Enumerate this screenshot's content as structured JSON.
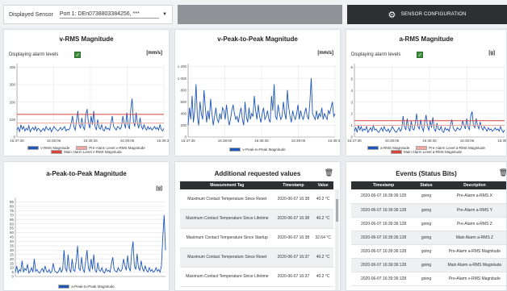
{
  "header": {
    "sensor_label": "Displayed Sensor",
    "sensor_value": "Port 1: DEn0738803384256, ***",
    "config_button": "SENSOR CONFIGURATION",
    "gear_icon": "gear-icon"
  },
  "alarm_label": "Displaying alarm levels",
  "check": "✓",
  "trash": "🗑",
  "panels": {
    "vrms": {
      "title": "v-RMS Magnitude",
      "unit": "[mm/s]",
      "legend": [
        "v-RMS Magnitude",
        "Pre-Alarm Level v-RMS Magnitude",
        "Main Alarm Level v-RMS Magnitude"
      ]
    },
    "vpp": {
      "title": "v-Peak-to-Peak Magnitude",
      "unit": "[mm/s]",
      "legend": [
        "v-Peak-to-Peak Magnitude"
      ]
    },
    "arms": {
      "title": "a-RMS Magnitude",
      "unit": "[g]",
      "legend": [
        "a-RMS Magnitude",
        "Pre-Alarm Level a-RMS Magnitude",
        "Main Alarm Level a-RMS Magnitude"
      ]
    },
    "app": {
      "title": "a-Peak-to-Peak Magnitude",
      "unit": "[g]",
      "legend": [
        "a-Peak-to-Peak Magnitude"
      ]
    }
  },
  "additional": {
    "title": "Additional requested values",
    "columns": [
      "Measurement Tag",
      "Timestamp",
      "Value"
    ],
    "rows": [
      [
        "Maximum Contact Temperature Since Reset",
        "2020-06-07 16:38",
        "40.2 °C"
      ],
      [
        "Maximum Contact Temperature Since Lifetime",
        "2020-06-07 16:38",
        "40.2 °C"
      ],
      [
        "Maximum Contact Temperature Since Startup",
        "2020-06-07 16:38",
        "32.64 °C"
      ],
      [
        "Maximum Contact Temperature Since Reset",
        "2020-06-07 16:37",
        "40.2 °C"
      ],
      [
        "Maximum Contact Temperature Since Lifetime",
        "2020-06-07 16:37",
        "40.2 °C"
      ]
    ]
  },
  "events": {
    "title": "Events (Status Bits)",
    "columns": [
      "Timestamp",
      "Status",
      "Description"
    ],
    "rows": [
      [
        "2020-06-07 16:39:36:128",
        "going",
        "Pre-Alarm a-RMS X"
      ],
      [
        "2020-06-07 16:39:36:128",
        "going",
        "Pre-Alarm a-RMS Y"
      ],
      [
        "2020-06-07 16:39:36:128",
        "going",
        "Pre-Alarm a-RMS Z"
      ],
      [
        "2020-06-07 16:39:36:128",
        "going",
        "Main Alarm a-RMS Z"
      ],
      [
        "2020-06-07 16:39:36:128",
        "going",
        "Pre-Alarm a-RMS Magnitude"
      ],
      [
        "2020-06-07 16:39:36:128",
        "going",
        "Main Alarm a-RMS Magnitude"
      ],
      [
        "2020-06-07 16:39:36:128",
        "going",
        "Pre-Alarm v-RMS Magnitude"
      ]
    ]
  },
  "colors": {
    "series": "#1f56b8",
    "pre_alarm": "#f2a69e",
    "main_alarm": "#d9443a",
    "header": "#2d2f33",
    "check": "#3f8f3f"
  },
  "chart_data": [
    {
      "type": "line",
      "title": "v-RMS Magnitude",
      "ylabel": "[mm/s]",
      "x_ticks": [
        "16:37:36",
        "16:38:06",
        "16:38:36",
        "16:39:06",
        "16:39:36"
      ],
      "y_ticks": [
        0,
        100,
        200,
        300,
        400
      ],
      "ylim": [
        0,
        420
      ],
      "series": [
        {
          "name": "v-RMS Magnitude",
          "values": [
            40,
            55,
            30,
            70,
            45,
            60,
            35,
            50,
            40,
            65,
            30,
            45,
            55,
            40,
            60,
            35,
            50,
            45,
            30,
            40,
            50,
            35,
            60,
            45,
            40,
            55,
            30,
            45,
            60,
            50,
            40,
            35,
            45,
            55,
            40,
            50,
            60,
            35,
            45,
            40,
            50,
            80,
            120,
            60,
            40,
            90,
            150,
            70,
            50,
            110,
            60,
            40,
            130,
            160,
            80,
            50,
            120,
            70,
            150,
            60,
            40,
            100,
            55,
            45,
            70,
            40,
            35,
            60,
            45,
            50,
            40,
            80,
            120,
            60,
            50,
            40,
            60,
            55,
            45,
            60,
            120,
            80,
            50,
            140,
            70,
            45,
            160,
            220,
            90,
            60,
            140,
            80,
            50,
            110,
            60,
            45,
            70,
            50,
            40,
            60,
            45,
            55,
            40,
            50,
            60,
            45,
            55,
            40,
            70,
            45,
            35,
            50
          ]
        },
        {
          "name": "Pre-Alarm Level v-RMS Magnitude",
          "values": [
            80
          ]
        },
        {
          "name": "Main Alarm Level v-RMS Magnitude",
          "values": [
            130
          ]
        }
      ]
    },
    {
      "type": "line",
      "title": "v-Peak-to-Peak Magnitude",
      "ylabel": "[mm/s]",
      "x_ticks": [
        "16:37:36",
        "16:38:06",
        "16:38:36",
        "16:39:06",
        "16:39:36"
      ],
      "y_ticks": [
        0,
        200,
        400,
        600,
        800,
        1000,
        1200
      ],
      "ylim": [
        0,
        1250
      ],
      "series": [
        {
          "name": "v-Peak-to-Peak Magnitude",
          "values": [
            200,
            500,
            300,
            700,
            250,
            450,
            900,
            350,
            200,
            600,
            400,
            300,
            800,
            500,
            250,
            450,
            300,
            650,
            400,
            200,
            350,
            500,
            300,
            250,
            400,
            300,
            500,
            450,
            300,
            550,
            350,
            200,
            300,
            450,
            550,
            400,
            300,
            350,
            250,
            400,
            500,
            300,
            200,
            600,
            350,
            250,
            500,
            300,
            400,
            350,
            700,
            450,
            300,
            550,
            350,
            250,
            400,
            500,
            300,
            350,
            450,
            300,
            250,
            700,
            450,
            900,
            350,
            300,
            550,
            400,
            300,
            350,
            600,
            400,
            300,
            800,
            500,
            350,
            250,
            450,
            350,
            300,
            400,
            550,
            300,
            450,
            350,
            300,
            400,
            500,
            350,
            300,
            600,
            1000,
            400,
            350,
            300,
            450,
            300,
            400,
            350,
            500,
            300,
            400,
            350,
            300,
            450,
            400,
            500,
            600,
            350,
            400
          ]
        }
      ]
    },
    {
      "type": "line",
      "title": "a-RMS Magnitude",
      "ylabel": "[g]",
      "x_ticks": [
        "16:37:36",
        "16:38:06",
        "16:38:36",
        "16:39:06",
        "16:39:36"
      ],
      "y_ticks": [
        0,
        1,
        2,
        3,
        4,
        5,
        6
      ],
      "ylim": [
        0,
        6.3
      ],
      "series": [
        {
          "name": "a-RMS Magnitude",
          "values": [
            0.5,
            0.8,
            0.4,
            1.0,
            0.6,
            0.9,
            0.5,
            0.7,
            0.6,
            0.9,
            0.4,
            0.6,
            0.8,
            0.5,
            1.0,
            0.6,
            0.7,
            0.5,
            0.4,
            0.6,
            0.8,
            0.5,
            0.9,
            0.6,
            0.5,
            0.7,
            0.4,
            0.6,
            0.9,
            0.7,
            0.5,
            0.4,
            0.6,
            0.8,
            0.5,
            0.7,
            1.8,
            0.9,
            0.6,
            1.6,
            0.8,
            0.5,
            1.4,
            0.7,
            0.6,
            1.2,
            2.0,
            0.9,
            0.7,
            1.5,
            0.8,
            0.5,
            1.3,
            1.9,
            0.9,
            0.6,
            1.4,
            0.8,
            1.7,
            0.7,
            0.5,
            1.2,
            0.7,
            0.6,
            0.9,
            0.5,
            0.4,
            0.8,
            0.6,
            0.7,
            0.5,
            1.0,
            1.5,
            0.8,
            0.6,
            0.5,
            0.8,
            0.7,
            0.6,
            0.8,
            1.4,
            1.0,
            0.7,
            1.6,
            0.9,
            0.6,
            1.8,
            2.2,
            1.0,
            0.8,
            1.6,
            1.0,
            0.7,
            1.3,
            0.8,
            0.6,
            0.9,
            0.7,
            0.5,
            0.8,
            0.6,
            0.7,
            0.5,
            0.6,
            0.8,
            0.6,
            0.7,
            0.5,
            0.9,
            0.6,
            0.4,
            0.6
          ]
        },
        {
          "name": "Pre-Alarm Level a-RMS Magnitude",
          "values": [
            1.0
          ]
        },
        {
          "name": "Main Alarm Level a-RMS Magnitude",
          "values": [
            1.4
          ]
        }
      ]
    },
    {
      "type": "line",
      "title": "a-Peak-to-Peak Magnitude",
      "ylabel": "[g]",
      "x_ticks": [],
      "y_ticks": [
        0,
        5,
        10,
        15,
        20,
        25,
        30,
        35,
        40,
        45,
        50,
        55,
        60,
        65,
        70,
        75,
        80,
        85
      ],
      "ylim": [
        0,
        90
      ],
      "series": [
        {
          "name": "a-Peak-to-Peak Magnitude",
          "values": [
            5,
            12,
            4,
            8,
            6,
            18,
            5,
            9,
            7,
            14,
            4,
            6,
            10,
            5,
            20,
            6,
            8,
            5,
            4,
            7,
            9,
            5,
            12,
            6,
            5,
            8,
            4,
            6,
            15,
            7,
            5,
            4,
            6,
            10,
            5,
            8,
            30,
            9,
            6,
            25,
            8,
            5,
            20,
            7,
            6,
            18,
            35,
            9,
            7,
            22,
            8,
            5,
            18,
            30,
            9,
            6,
            20,
            8,
            25,
            7,
            5,
            16,
            7,
            6,
            10,
            5,
            4,
            9,
            6,
            7,
            5,
            14,
            22,
            8,
            6,
            5,
            10,
            7,
            6,
            9,
            20,
            12,
            7,
            24,
            10,
            6,
            28,
            40,
            12,
            8,
            26,
            10,
            7,
            18,
            9,
            6,
            12,
            7,
            5,
            10,
            6,
            8,
            5,
            6,
            10,
            6,
            8,
            5,
            12,
            45,
            70,
            30
          ]
        }
      ]
    }
  ]
}
